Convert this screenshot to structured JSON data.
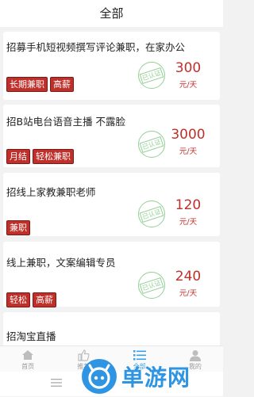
{
  "header": {
    "title": "全部"
  },
  "jobs": [
    {
      "title": "招募手机短视频撰写评论兼职，在家办公",
      "tags": [
        "长期兼职",
        "高薪"
      ],
      "stamp": "已认证",
      "price": "300",
      "unit": "元/天"
    },
    {
      "title": "招B站电台语音主播 不露脸",
      "tags": [
        "月结",
        "轻松兼职"
      ],
      "stamp": "已认证",
      "price": "3000",
      "unit": "元/天"
    },
    {
      "title": "招线上家教兼职老师",
      "tags": [
        "兼职"
      ],
      "stamp": "已认证",
      "price": "120",
      "unit": "元/天"
    },
    {
      "title": "线上兼职，文案编辑专员",
      "tags": [
        "轻松",
        "高薪"
      ],
      "stamp": "已认证",
      "price": "240",
      "unit": "元/天"
    },
    {
      "title": "招淘宝直播"
    }
  ],
  "tabbar": [
    {
      "label": "首页",
      "icon": "home-icon"
    },
    {
      "label": "推荐",
      "icon": "thumbs-up-icon"
    },
    {
      "label": "全部",
      "icon": "list-icon"
    },
    {
      "label": "我的",
      "icon": "user-icon"
    }
  ],
  "watermark": {
    "text": "单游网"
  },
  "colors": {
    "accent": "#c0302a",
    "active": "#3aa0e6",
    "stamp": "#4caf50",
    "watermark": "#2f95e3"
  }
}
